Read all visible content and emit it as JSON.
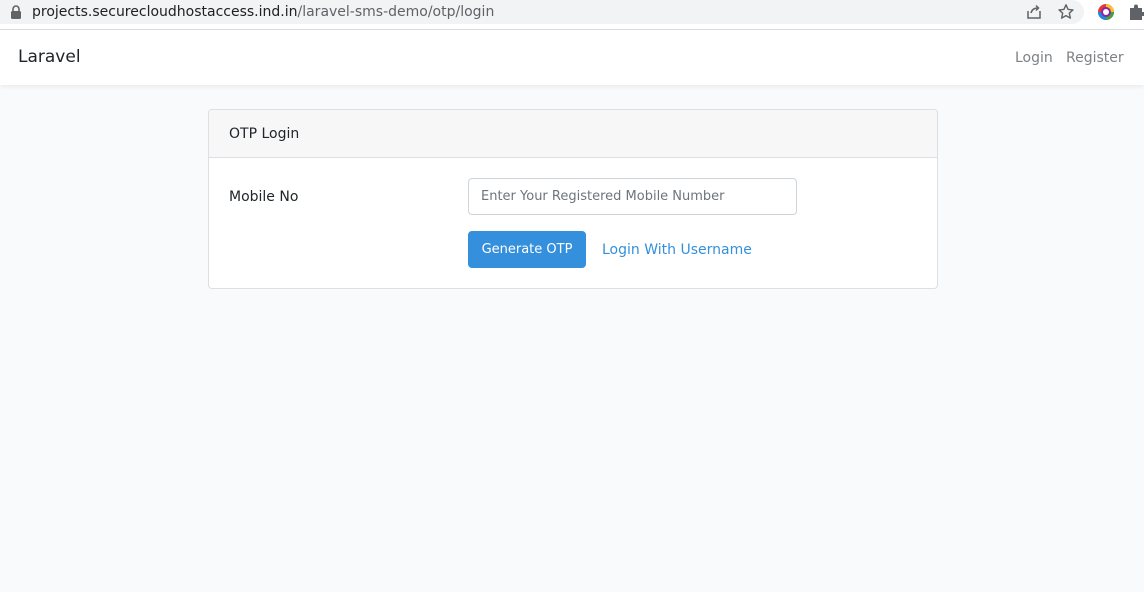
{
  "browser": {
    "url_host": "projects.securecloudhostaccess.ind.in",
    "url_path": "/laravel-sms-demo/otp/login",
    "icons": [
      "lock-icon",
      "share-icon",
      "star-icon",
      "extension-icon",
      "puzzle-icon"
    ]
  },
  "navbar": {
    "brand": "Laravel",
    "links": {
      "login": "Login",
      "register": "Register"
    }
  },
  "card": {
    "title": "OTP Login",
    "mobile_label": "Mobile No",
    "mobile_input": {
      "value": "",
      "placeholder": "Enter Your Registered Mobile Number"
    },
    "generate_button": "Generate OTP",
    "username_link": "Login With Username"
  },
  "colors": {
    "primary": "#3490dc",
    "page_background": "#f8fafc",
    "card_header": "#f7f7f7"
  }
}
